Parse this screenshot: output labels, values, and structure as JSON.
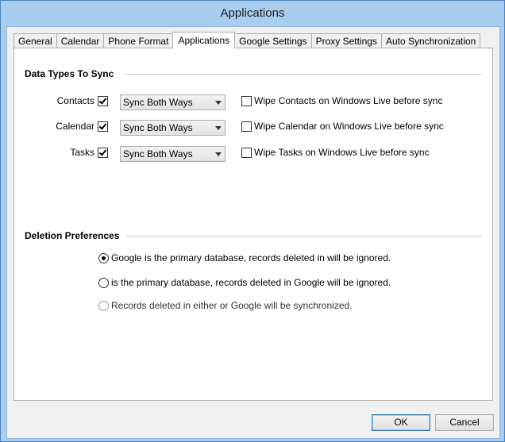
{
  "window": {
    "title": "Applications"
  },
  "tabs": [
    {
      "label": "General",
      "active": false
    },
    {
      "label": "Calendar",
      "active": false
    },
    {
      "label": "Phone Format",
      "active": false
    },
    {
      "label": "Applications",
      "active": true
    },
    {
      "label": "Google Settings",
      "active": false
    },
    {
      "label": "Proxy Settings",
      "active": false
    },
    {
      "label": "Auto Synchronization",
      "active": false
    }
  ],
  "data_types": {
    "title": "Data Types To Sync",
    "rows": [
      {
        "label": "Contacts",
        "checked": true,
        "mode": "Sync Both Ways",
        "wipe_label": "Wipe Contacts on Windows Live before sync",
        "wipe_checked": false
      },
      {
        "label": "Calendar",
        "checked": true,
        "mode": "Sync Both Ways",
        "wipe_label": "Wipe Calendar on Windows Live before sync",
        "wipe_checked": false
      },
      {
        "label": "Tasks",
        "checked": true,
        "mode": "Sync Both Ways",
        "wipe_label": "Wipe Tasks on Windows Live before sync",
        "wipe_checked": false
      }
    ]
  },
  "deletion": {
    "title": "Deletion Preferences",
    "options": [
      {
        "label": "Google is the primary database, records deleted in  will be ignored.",
        "selected": true,
        "enabled": true
      },
      {
        "label": "is the primary database, records deleted in Google will be ignored.",
        "selected": false,
        "enabled": true
      },
      {
        "label": "Records deleted in either  or Google will be synchronized.",
        "selected": false,
        "enabled": false
      }
    ]
  },
  "buttons": {
    "ok": "OK",
    "cancel": "Cancel"
  }
}
